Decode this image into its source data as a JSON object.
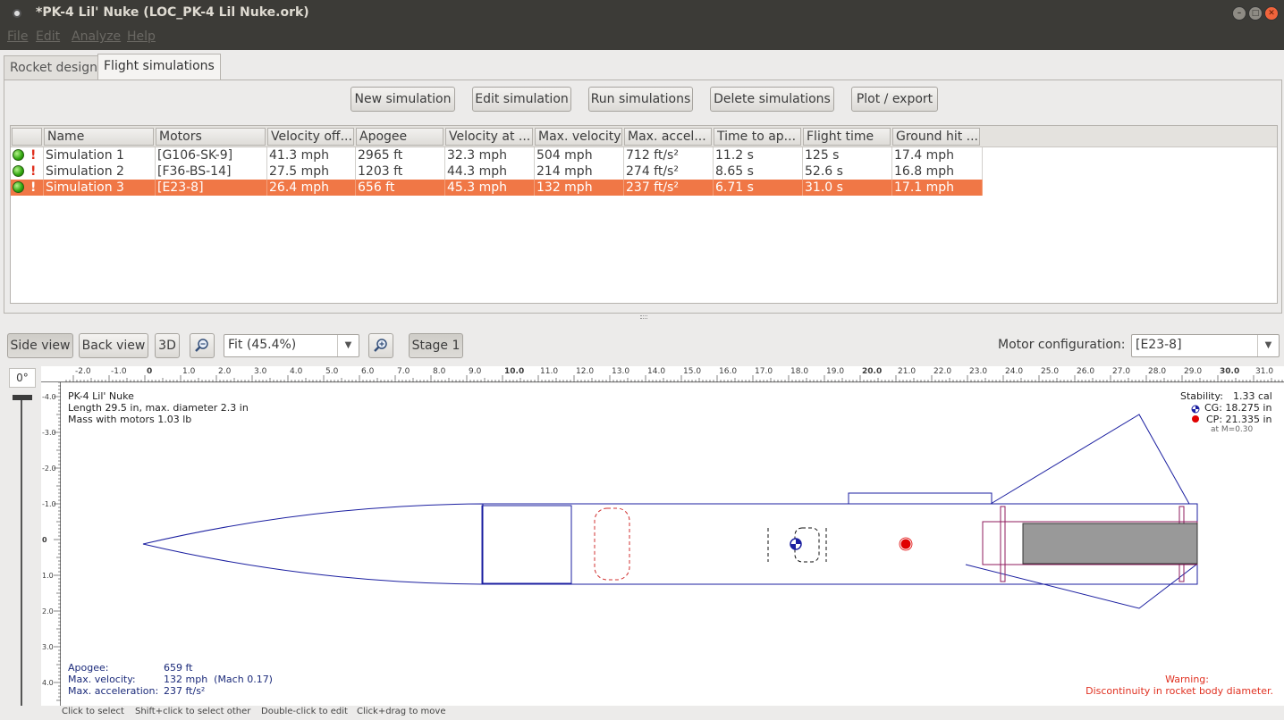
{
  "window": {
    "title": "*PK-4 Lil' Nuke (LOC_PK-4 Lil Nuke.ork)"
  },
  "menu": [
    "File",
    "Edit",
    "Analyze",
    "Help"
  ],
  "tabs": [
    "Rocket design",
    "Flight simulations"
  ],
  "toolbar": {
    "new_simulation": "New simulation",
    "edit_simulation": "Edit simulation",
    "run_simulations": "Run simulations",
    "delete_simulations": "Delete simulations",
    "plot_export": "Plot / export"
  },
  "table": {
    "columns": [
      "Name",
      "Motors",
      "Velocity off...",
      "Apogee",
      "Velocity at ...",
      "Max. velocity",
      "Max. accel...",
      "Time to ap...",
      "Flight time",
      "Ground hit ..."
    ],
    "rows": [
      {
        "status": "!",
        "name": "Simulation 1",
        "motors": "[G106-SK-9]",
        "vel_off": "41.3 mph",
        "apogee": "2965 ft",
        "vel_at": "32.3 mph",
        "max_vel": "504 mph",
        "max_accel": "712 ft/s²",
        "time_ap": "11.2 s",
        "flight_time": "125 s",
        "ground_hit": "17.4 mph",
        "selected": false
      },
      {
        "status": "!",
        "name": "Simulation 2",
        "motors": "[F36-BS-14]",
        "vel_off": "27.5 mph",
        "apogee": "1203 ft",
        "vel_at": "44.3 mph",
        "max_vel": "214 mph",
        "max_accel": "274 ft/s²",
        "time_ap": "8.65 s",
        "flight_time": "52.6 s",
        "ground_hit": "16.8 mph",
        "selected": false
      },
      {
        "status": "!",
        "name": "Simulation 3",
        "motors": "[E23-8]",
        "vel_off": "26.4 mph",
        "apogee": "656 ft",
        "vel_at": "45.3 mph",
        "max_vel": "132 mph",
        "max_accel": "237 ft/s²",
        "time_ap": "6.71 s",
        "flight_time": "31.0 s",
        "ground_hit": "17.1 mph",
        "selected": true
      }
    ]
  },
  "view_toolbar": {
    "side_view": "Side view",
    "back_view": "Back view",
    "view_3d": "3D",
    "zoom": "Fit (45.4%)",
    "stage": "Stage 1",
    "motor_config_label": "Motor configuration:",
    "motor_config": "[E23-8]"
  },
  "rotation": "0°",
  "ruler": {
    "unit": "in",
    "top": [
      "-2.0",
      "-1.0",
      "0",
      "1.0",
      "2.0",
      "3.0",
      "4.0",
      "5.0",
      "6.0",
      "7.0",
      "8.0",
      "9.0",
      "10.0",
      "11.0",
      "12.0",
      "13.0",
      "14.0",
      "15.0",
      "16.0",
      "17.0",
      "18.0",
      "19.0",
      "20.0",
      "21.0",
      "22.0",
      "23.0",
      "24.0",
      "25.0",
      "26.0",
      "27.0",
      "28.0",
      "29.0",
      "30.0",
      "31.0"
    ],
    "left": [
      "-4.0",
      "-3.0",
      "-2.0",
      "-1.0",
      "0",
      "1.0",
      "2.0",
      "3.0",
      "4.0"
    ]
  },
  "rocket_info": {
    "name": "PK-4 Lil' Nuke",
    "length": "Length 29.5 in, max. diameter 2.3 in",
    "mass": "Mass with motors 1.03 lb"
  },
  "stability": {
    "label": "Stability:",
    "value": "1.33 cal",
    "cg": "CG: 18.275 in",
    "cp": "CP: 21.335 in",
    "mach": "at M=0.30"
  },
  "flight": {
    "apogee_label": "Apogee:",
    "apogee": "659 ft",
    "maxvel_label": "Max. velocity:",
    "maxvel": "132 mph  (Mach 0.17)",
    "maxacc_label": "Max. acceleration:",
    "maxacc": "237 ft/s²"
  },
  "warning": {
    "title": "Warning:",
    "text": "Discontinuity in rocket body diameter."
  },
  "status_hints": [
    "Click to select",
    "Shift+click to select other",
    "Double-click to edit",
    "Click+drag to move"
  ],
  "colors": {
    "selection": "#f07746",
    "body_outline": "#1b1fa0",
    "cp": "#e00000",
    "motor": "#8f1b5e",
    "warning": "#e03020"
  }
}
